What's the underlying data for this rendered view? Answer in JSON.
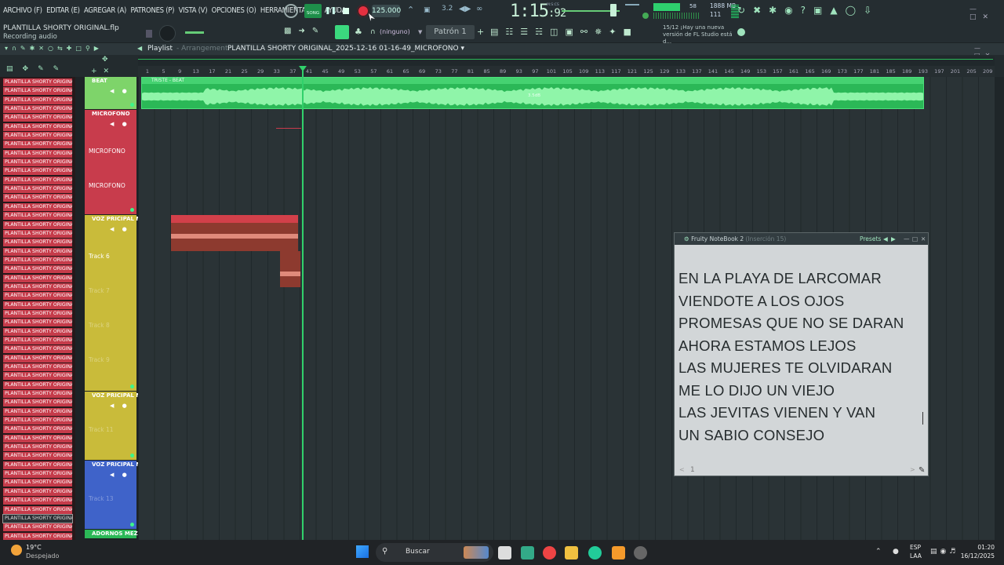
{
  "menu": {
    "items": [
      "ARCHIVO (F)",
      "EDITAR (E)",
      "AGREGAR (A)",
      "PATRONES (P)",
      "VISTA (V)",
      "OPCIONES (O)",
      "HERRAMIENTAS (T)",
      "AYUDA"
    ]
  },
  "project": {
    "file_name": "PLANTILLA SHORTY ORIGINAL.flp",
    "hint": "Recording audio"
  },
  "transport": {
    "tempo": "125.000",
    "song_label": "SONG",
    "time_main": "1:15",
    "time_small": ":92",
    "time_unit": "M:S:CS",
    "cpu": "58",
    "memory": "1888 MB",
    "polyphony": "111"
  },
  "toolbar": {
    "snap": "(ninguno)",
    "pattern": "Patrón 1"
  },
  "news": {
    "counter": "15/12",
    "text": "¡Hay una nueva versión de FL Studio está d..."
  },
  "playlist": {
    "title": "Playlist",
    "subtitle": "Arrangement",
    "project_name": "PLANTILLA SHORTY ORIGINAL_2025-12-16 01-16-49_MICROFONO",
    "ruler": [
      "1",
      "5",
      "9",
      "13",
      "17",
      "21",
      "25",
      "29",
      "33",
      "37",
      "41",
      "45",
      "49",
      "53",
      "57",
      "61",
      "65",
      "69",
      "73",
      "77",
      "81",
      "85",
      "89",
      "93",
      "97",
      "101",
      "105",
      "109",
      "113",
      "117",
      "121",
      "125",
      "129",
      "133",
      "137",
      "141",
      "145",
      "149",
      "153",
      "157",
      "161",
      "165",
      "169",
      "173",
      "177",
      "181",
      "185",
      "189",
      "193",
      "197",
      "201",
      "205",
      "209"
    ]
  },
  "patterns": {
    "item_label": "PLANTILLA SHORTY ORIGINA...",
    "count": 52,
    "selected_index": 49
  },
  "tracks": [
    {
      "name": "BEAT",
      "color": "#7ed46a",
      "lines": []
    },
    {
      "name": "MICROFONO",
      "color": "#c83c4c",
      "lines": [
        "MICROFONO",
        "MICROFONO"
      ]
    },
    {
      "name": "VOZ PRICIPAL M...",
      "color": "#c9bb3a",
      "lines": [
        "Track 6",
        "Track 7",
        "Track 8",
        "Track 9"
      ]
    },
    {
      "name": "VOZ PRICIPAL M...",
      "color": "#c9bb3a",
      "lines": [
        "Track 11"
      ]
    },
    {
      "name": "VOZ PRICIPAL M...",
      "color": "#3f63c9",
      "lines": [
        "Track 13"
      ]
    },
    {
      "name": "ADORNOS MEZCLA",
      "color": "#2bb857",
      "lines": []
    }
  ],
  "clips": {
    "beat_clip": "TRISTE - BEAT",
    "beat_marker": "3.5dB"
  },
  "notebook": {
    "title": "Fruity NoteBook 2",
    "subtitle": "(Inserción 15)",
    "presets": "Presets",
    "page": "1",
    "lines": [
      "EN LA PLAYA DE LARCOMAR",
      "VIENDOTE A LOS OJOS",
      "PROMESAS QUE NO SE DARAN",
      "AHORA ESTAMOS LEJOS",
      "LAS MUJERES TE OLVIDARAN",
      "ME LO DIJO UN VIEJO",
      "LAS JEVITAS VIENEN Y VAN",
      "UN SABIO CONSEJO"
    ]
  },
  "taskbar": {
    "temperature": "19°C",
    "weather": "Despejado",
    "search_placeholder": "Buscar",
    "lang": "ESP",
    "lang2": "LAA",
    "clock_time": "01:20",
    "clock_date": "16/12/2025"
  },
  "colors": {
    "accent_green": "#31d16b",
    "record_red": "#e53040",
    "pattern_red": "#c63b4a"
  }
}
